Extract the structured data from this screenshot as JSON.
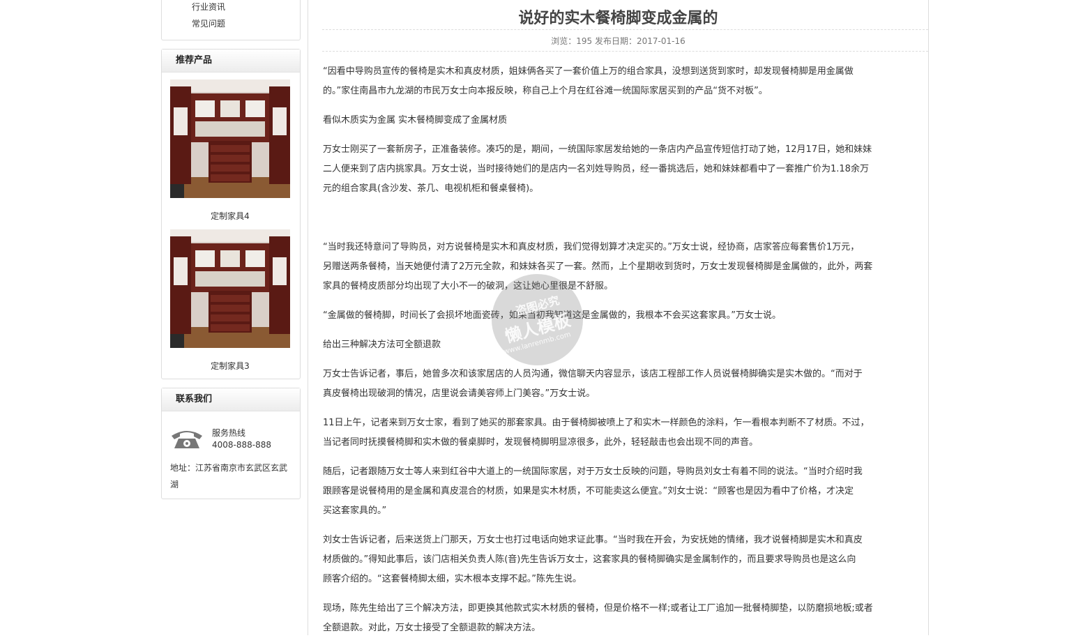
{
  "sidebar": {
    "categories": [
      "行业资讯",
      "常见问题"
    ],
    "recommend": {
      "title": "推荐产品",
      "products": [
        {
          "name": "定制家具4"
        },
        {
          "name": "定制家具3"
        }
      ]
    },
    "contact": {
      "title": "联系我们",
      "hotline_label": "服务热线",
      "hotline": "4008-888-888",
      "address_label": "地址：",
      "address": "江苏省南京市玄武区玄武湖"
    }
  },
  "article": {
    "title": "说好的实木餐椅脚变成金属的",
    "meta": "浏览：195 发布日期：2017-01-16",
    "paragraphs": [
      [
        "“因看中导购员宣传的餐椅是实木和真皮材质，姐妹俩各买了一套价值上万的组合家具，没想到送货到家时，却发现餐椅脚是用金属做",
        "的。”家住南昌市九龙湖的市民万女士向本报反映，称自己上个月在红谷滩一统国际家居买到的产品“货不对板”。"
      ],
      [
        "看似木质实为金属 实木餐椅脚变成了金属材质"
      ],
      [
        "万女士刚买了一套新房子，正准备装修。凑巧的是，期间，一统国际家居发给她的一条店内产品宣传短信打动了她，12月17日，她和妹妹",
        "二人便来到了店内挑家具。万女士说，当时接待她们的是店内一名刘姓导购员，经一番挑选后，她和妹妹都看中了一套推广价为1.18余万",
        "元的组合家具(含沙发、茶几、电视机柜和餐桌餐椅)。"
      ],
      [
        "“当时我还特意问了导购员，对方说餐椅是实木和真皮材质，我们觉得划算才决定买的。”万女士说，经协商，店家答应每套售价1万元，",
        "另赠送两条餐椅，当天她便付清了2万元全款，和妹妹各买了一套。然而，上个星期收到货时，万女士发现餐椅脚是金属做的，此外，两套",
        "家具的餐椅皮质部分均出现了大小不一的破洞，这让她心里很是不舒服。"
      ],
      [
        "“金属做的餐椅脚，时间长了会损坏地面瓷砖，如果当初我知道这是金属做的，我根本不会买这套家具。”万女士说。"
      ],
      [
        "给出三种解决方法可全额退款"
      ],
      [
        "万女士告诉记者，事后，她曾多次和该家居店的人员沟通，微信聊天内容显示，该店工程部工作人员说餐椅脚确实是实木做的。“而对于",
        "真皮餐椅出现破洞的情况，店里说会请美容师上门美容。”万女士说。"
      ],
      [
        "11日上午，记者来到万女士家，看到了她买的那套家具。由于餐椅脚被喷上了和实木一样颜色的涂料，乍一看根本判断不了材质。不过，",
        "当记者同时抚摸餐椅脚和实木做的餐桌脚时，发现餐椅脚明显凉很多，此外，轻轻敲击也会出现不同的声音。"
      ],
      [
        "随后，记者跟随万女士等人来到红谷中大道上的一统国际家居，对于万女士反映的问题，导购员刘女士有着不同的说法。“当时介绍时我",
        "跟顾客是说餐椅用的是金属和真皮混合的材质，如果是实木材质，不可能卖这么便宜。”刘女士说：“顾客也是因为看中了价格，才决定",
        "买这套家具的。”"
      ],
      [
        "刘女士告诉记者，后来送货上门那天，万女士也打过电话向她求证此事。“当时我在开会，为安抚她的情绪，我才说餐椅脚是实木和真皮",
        "材质做的。”得知此事后，该门店相关负责人陈(音)先生告诉万女士，这套家具的餐椅脚确实是金属制作的，而且要求导购员也是这么向",
        "顾客介绍的。“这套餐椅脚太细，实木根本支撑不起。”陈先生说。"
      ],
      [
        "现场，陈先生给出了三个解决方法，即更换其他款式实木材质的餐椅，但是价格不一样;或者让工厂追加一批餐椅脚垫，以防磨损地板;或者",
        "全额退款。对此，万女士接受了全额退款的解决方法。"
      ]
    ]
  },
  "watermark": {
    "line1": "盗图必究",
    "line2": "懒人模板",
    "line3": "www.lanrenmb.com"
  },
  "colors": {
    "border": "#dddddd",
    "title": "#444444",
    "wood": "#5a1a14"
  }
}
